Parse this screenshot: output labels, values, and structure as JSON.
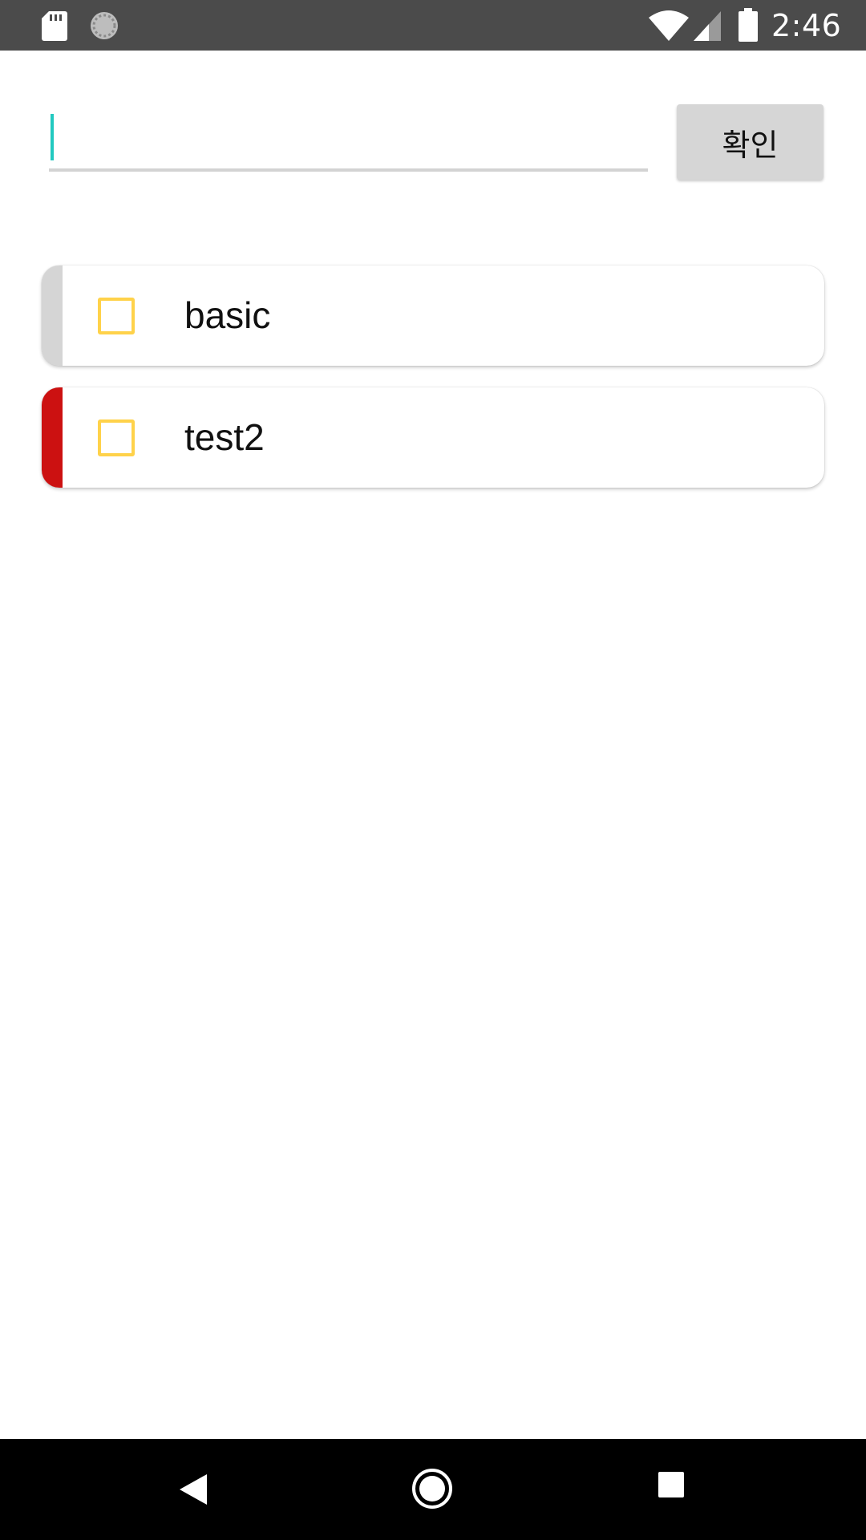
{
  "status_bar": {
    "time": "2:46",
    "icons": [
      "sd-card-icon",
      "sync-icon",
      "wifi-icon",
      "cell-signal-icon",
      "battery-icon"
    ]
  },
  "input": {
    "value": "",
    "placeholder": ""
  },
  "confirm_button": {
    "label": "확인"
  },
  "todo_items": [
    {
      "label": "basic",
      "checked": false,
      "color": "#d5d5d5"
    },
    {
      "label": "test2",
      "checked": false,
      "color": "#cc1111"
    }
  ],
  "colors": {
    "status_bar_bg": "#4b4b4b",
    "accent_cursor": "#22c9c0",
    "checkbox_border": "#ffd24a",
    "button_bg": "#d6d6d6",
    "nav_bar_bg": "#000000"
  },
  "nav_bar": {
    "icons": [
      "back-icon",
      "home-icon",
      "recents-icon"
    ]
  }
}
